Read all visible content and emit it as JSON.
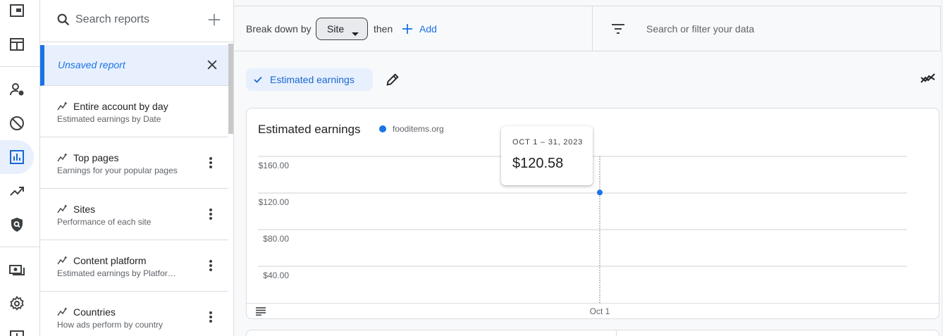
{
  "search": {
    "placeholder": "Search reports"
  },
  "unsaved_report": {
    "label": "Unsaved report"
  },
  "reports": [
    {
      "title": "Entire account by day",
      "subtitle": "Estimated earnings by Date",
      "has_menu": false
    },
    {
      "title": "Top pages",
      "subtitle": "Earnings for your popular pages",
      "has_menu": true
    },
    {
      "title": "Sites",
      "subtitle": "Performance of each site",
      "has_menu": true
    },
    {
      "title": "Content platform",
      "subtitle": "Estimated earnings by Platfor…",
      "has_menu": true
    },
    {
      "title": "Countries",
      "subtitle": "How ads perform by country",
      "has_menu": true
    }
  ],
  "toolbar": {
    "breakdown_label": "Break down by",
    "breakdown_value": "Site",
    "then_label": "then",
    "add_label": "Add",
    "filter_placeholder": "Search or filter your data"
  },
  "metric_chip": {
    "label": "Estimated earnings"
  },
  "rail": {
    "icons": [
      "overview-icon",
      "ads-icon",
      "privacy-messaging-icon",
      "blocking-controls-icon",
      "reports-icon",
      "optimization-icon",
      "brand-safety-icon",
      "payments-icon",
      "settings-icon",
      "more-icon"
    ],
    "active": "reports-icon"
  },
  "colors": {
    "accent": "#1a73e8",
    "active_bg": "#e8f0fe",
    "series": "#1a73e8"
  },
  "chart_data": {
    "type": "line",
    "title": "Estimated earnings",
    "series": [
      {
        "name": "fooditems.org",
        "x": [
          "Oct 1"
        ],
        "y": [
          120.58
        ]
      }
    ],
    "x_ticks": [
      "Oct 1"
    ],
    "y_ticks": [
      "$40.00",
      "$80.00",
      "$120.00",
      "$160.00"
    ],
    "y_tick_values": [
      40,
      80,
      120,
      160
    ],
    "ylim": [
      0,
      160
    ],
    "grid": true,
    "legend": "top-left",
    "tooltip": {
      "date": "OCT 1 – 31, 2023",
      "value": "$120.58"
    }
  }
}
